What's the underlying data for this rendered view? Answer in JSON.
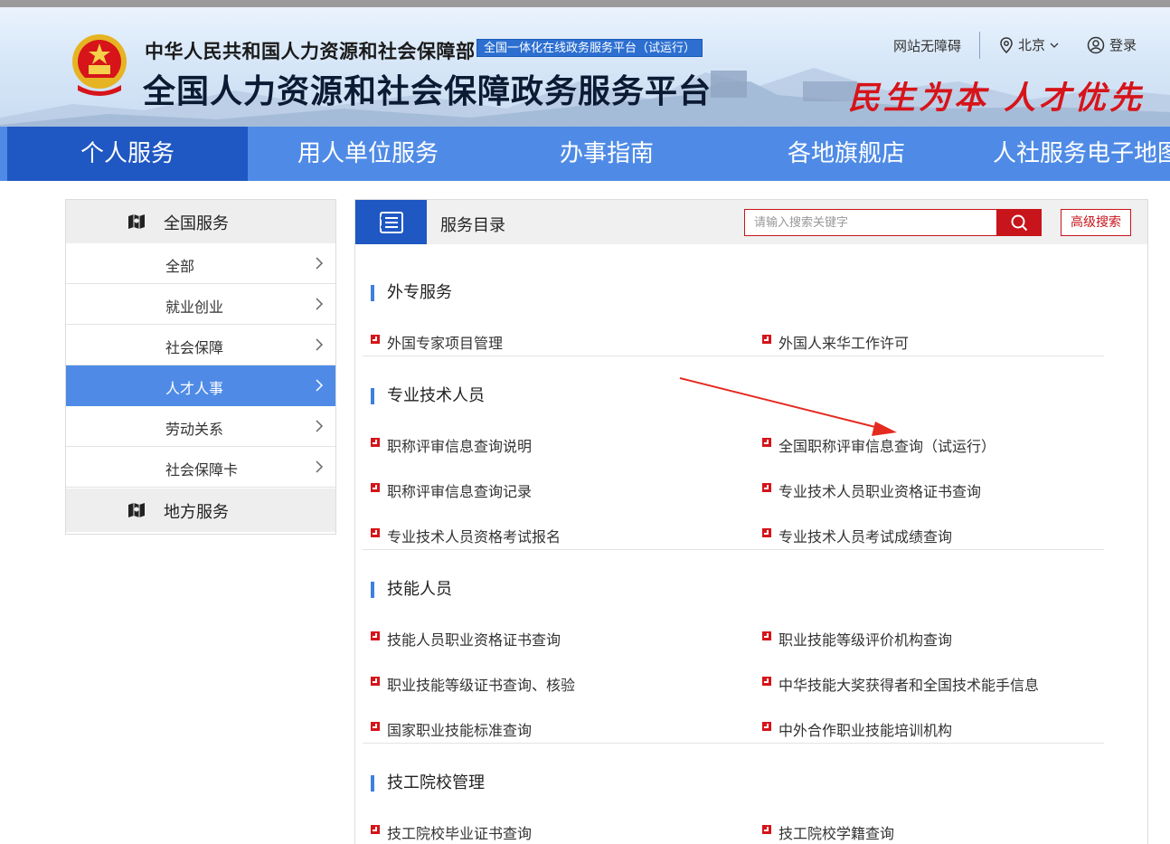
{
  "header": {
    "ministry_name": "中华人民共和国人力资源和社会保障部",
    "trial_badge": "全国一体化在线政务服务平台（试运行）",
    "platform_title": "全国人力资源和社会保障政务服务平台",
    "slogan": "民生为本 人才优先",
    "accessibility": "网站无障碍",
    "city": "北京",
    "login": "登录"
  },
  "nav": {
    "items": [
      {
        "label": "个人服务"
      },
      {
        "label": "用人单位服务"
      },
      {
        "label": "办事指南"
      },
      {
        "label": "各地旗舰店"
      },
      {
        "label": "人社服务电子地图"
      }
    ],
    "active_index": 0
  },
  "sidebar": {
    "national_heading": "全国服务",
    "items": [
      {
        "label": "全部"
      },
      {
        "label": "就业创业"
      },
      {
        "label": "社会保障"
      },
      {
        "label": "人才人事"
      },
      {
        "label": "劳动关系"
      },
      {
        "label": "社会保障卡"
      }
    ],
    "active_index": 3,
    "local_heading": "地方服务"
  },
  "panel": {
    "title": "服务目录",
    "search_placeholder": "请输入搜索关键字",
    "advanced_search": "高级搜索",
    "sections": [
      {
        "title": "外专服务",
        "links": [
          "外国专家项目管理",
          "外国人来华工作许可"
        ]
      },
      {
        "title": "专业技术人员",
        "links": [
          "职称评审信息查询说明",
          "全国职称评审信息查询（试运行）",
          "职称评审信息查询记录",
          "专业技术人员职业资格证书查询",
          "专业技术人员资格考试报名",
          "专业技术人员考试成绩查询"
        ]
      },
      {
        "title": "技能人员",
        "links": [
          "技能人员职业资格证书查询",
          "职业技能等级评价机构查询",
          "职业技能等级证书查询、核验",
          "中华技能大奖获得者和全国技术能手信息",
          "国家职业技能标准查询",
          "中外合作职业技能培训机构"
        ]
      },
      {
        "title": "技工院校管理",
        "links": [
          "技工院校毕业证书查询",
          "技工院校学籍查询"
        ]
      }
    ]
  },
  "colors": {
    "nav_bg": "#4f8be6",
    "nav_active": "#1f57c3",
    "accent_red": "#c8141b",
    "slogan_red": "#d6141a"
  }
}
